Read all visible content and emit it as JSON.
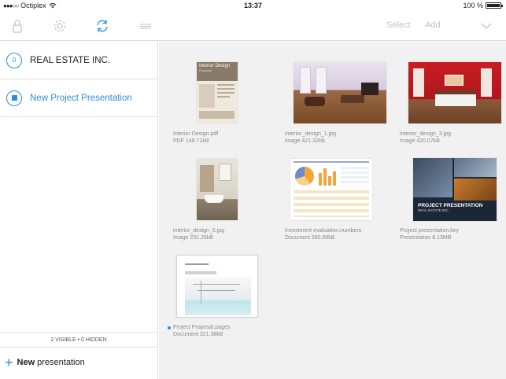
{
  "status": {
    "signal_dots": "●●●○○",
    "carrier": "Octiplex",
    "time": "13:37",
    "battery_level": "100 %",
    "battery_fraction": 1.0
  },
  "toolbar": {
    "select_label": "Select",
    "add_label": "Add"
  },
  "sidebar": {
    "items": [
      {
        "badge": "0",
        "label": "REAL ESTATE INC."
      },
      {
        "label": "New Project Presentation"
      }
    ],
    "visibility": "2 VISIBLE • 0 HIDDEN",
    "new_presentation_bold": "New",
    "new_presentation_rest": "presentation"
  },
  "thumb_text": {
    "interior_title": "Interior Design",
    "interior_sub": "Proposal",
    "key_title": "PROJECT PRESENTATION",
    "key_sub": "REAL ESTATE INC."
  },
  "files": [
    {
      "name": "Interior Design.pdf",
      "info": "PDF 146.71kB"
    },
    {
      "name": "interior_design_1.jpg",
      "info": "Image 421.32kB"
    },
    {
      "name": "interior_design_3.jpg",
      "info": "Image 420.07kB"
    },
    {
      "name": "interior_design_5.jpg",
      "info": "Image 231.26kB"
    },
    {
      "name": "Investment evaluation.numbers",
      "info": "Document 280.66kB"
    },
    {
      "name": "Project presentation.key",
      "info": "Presentation 8.13MB"
    },
    {
      "name": "Project Proposal.pages",
      "info": "Document 321.38kB"
    }
  ],
  "colors": {
    "accent": "#2a90d9",
    "content_bg": "#f1f1f1",
    "muted_text": "#8a8a8a"
  }
}
